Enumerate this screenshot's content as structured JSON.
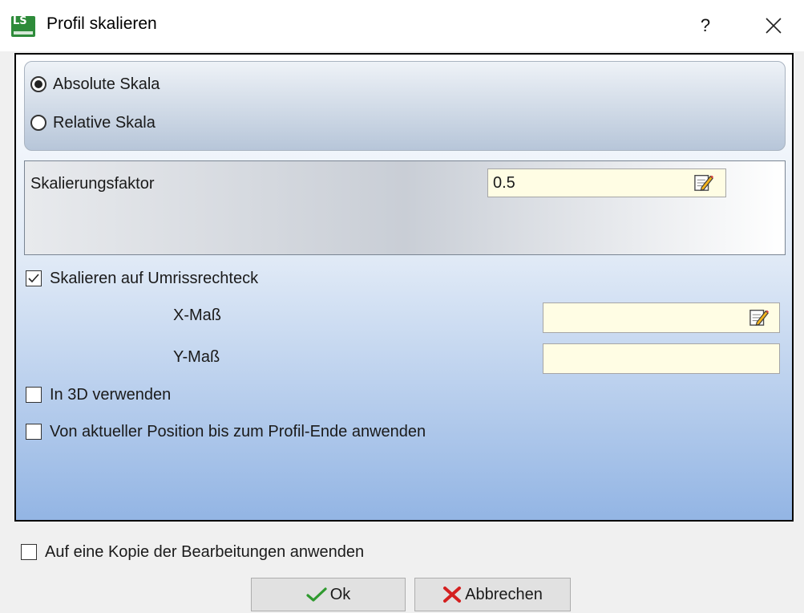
{
  "window": {
    "title": "Profil skalieren",
    "help_label": "?"
  },
  "scale_mode": {
    "options": [
      {
        "label": "Absolute Skala",
        "selected": true
      },
      {
        "label": "Relative Skala",
        "selected": false
      }
    ]
  },
  "factor": {
    "label": "Skalierungsfaktor",
    "value": "0.5"
  },
  "bounding": {
    "checkbox_label": "Skalieren auf Umrissrechteck",
    "checked": true,
    "x_label": "X-Maß",
    "x_value": "",
    "y_label": "Y-Maß",
    "y_value": ""
  },
  "options": {
    "use_3d_label": "In 3D verwenden",
    "use_3d_checked": false,
    "from_position_label": "Von aktueller Position bis zum Profil-Ende anwenden",
    "from_position_checked": false
  },
  "copy": {
    "label": "Auf eine Kopie der Bearbeitungen anwenden",
    "checked": false
  },
  "buttons": {
    "ok_label": "Ok",
    "cancel_label": "Abbrechen"
  },
  "icons": {
    "app": "app-logo-icon",
    "edit": "notepad-pencil-icon",
    "ok": "green-checkmark-icon",
    "cancel": "red-x-icon"
  }
}
